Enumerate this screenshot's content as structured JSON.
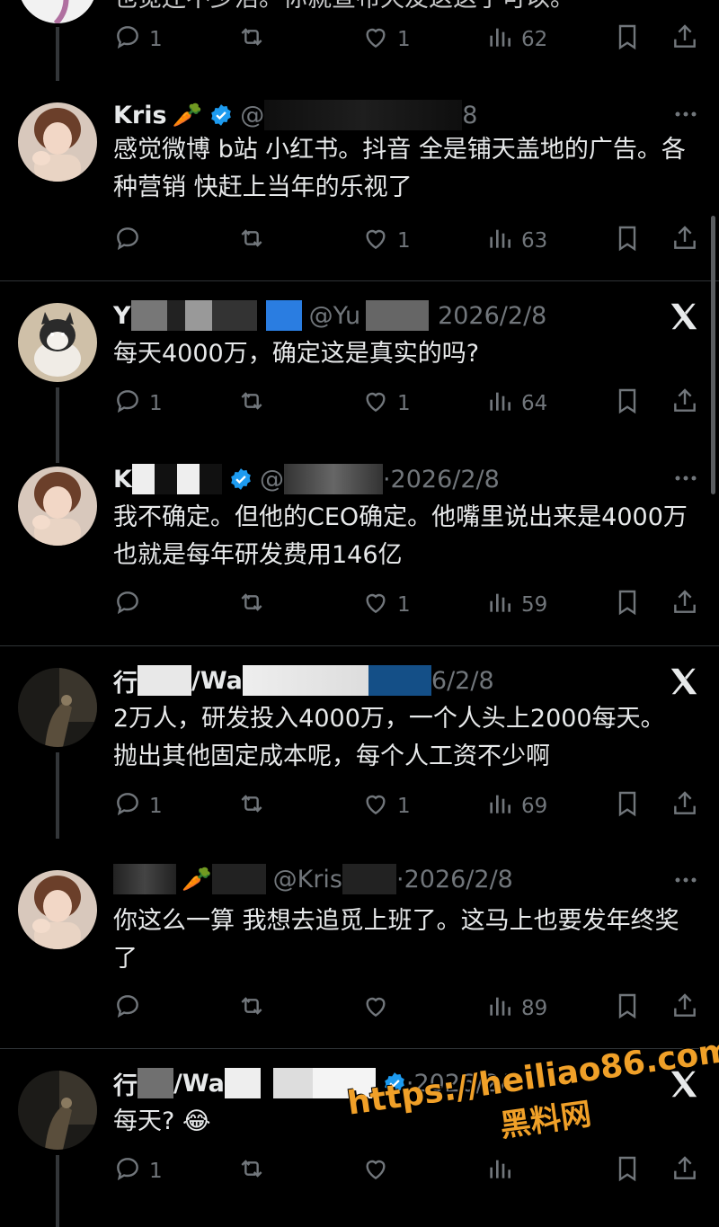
{
  "colors": {
    "background": "#000000",
    "text": "#e7e9ea",
    "muted": "#71767b",
    "verified": "#1d9bf0",
    "divider": "#2f3336",
    "watermark": "#f0a028"
  },
  "top": {
    "text": "也觉还不少活。你就宣布天友这这了可以。",
    "stats": {
      "reply": "1",
      "like": "1",
      "views": "62"
    }
  },
  "posts": [
    {
      "name": "Kris",
      "emoji": "🥕",
      "handle": "@",
      "sep": "",
      "date": "8",
      "text": "感觉微博 b站 小红书。抖音 全是铺天盖地的广告。各种营销  快赶上当年的乐视了",
      "stats": {
        "reply": "",
        "like": "1",
        "views": "63"
      }
    },
    {
      "name": "Y",
      "emoji": "",
      "handle": "@Yu",
      "sep": "",
      "date": "2026/2/8",
      "text": "每天4000万，确定这是真实的吗?",
      "stats": {
        "reply": "1",
        "like": "1",
        "views": "64"
      }
    },
    {
      "name": "K",
      "emoji": "",
      "handle": "@",
      "sep": "·",
      "date": "2026/2/8",
      "text": "我不确定。但他的CEO确定。他嘴里说出来是4000万 也就是每年研发费用146亿",
      "stats": {
        "reply": "",
        "like": "1",
        "views": "59"
      }
    },
    {
      "name": "行",
      "emoji": "",
      "handle": "/Wa",
      "sep": "",
      "date": "6/2/8",
      "text": "2万人，研发投入4000万，一个人头上2000每天。抛出其他固定成本呢，每个人工资不少啊",
      "stats": {
        "reply": "1",
        "like": "1",
        "views": "69"
      }
    },
    {
      "name": "",
      "emoji": "🥕",
      "handle": "@Kris",
      "sep": "·",
      "date": "2026/2/8",
      "text": "你这么一算 我想去追觅上班了。这马上也要发年终奖了",
      "stats": {
        "reply": "",
        "like": "",
        "views": "89"
      }
    },
    {
      "name": "行",
      "emoji": "",
      "handle": "/Wa",
      "sep": "·",
      "date": "2026/2/8",
      "text": "每天?",
      "text_emoji": "😂",
      "stats": {
        "reply": "1",
        "like": "",
        "views": ""
      }
    }
  ],
  "icons": [
    "reply-icon",
    "retweet-icon",
    "like-icon",
    "views-icon",
    "bookmark-icon",
    "share-icon",
    "more-icon",
    "x-logo-icon",
    "verified-badge-icon"
  ],
  "watermark": {
    "url": "https://heiliao86.com",
    "cn": "黑料网"
  }
}
